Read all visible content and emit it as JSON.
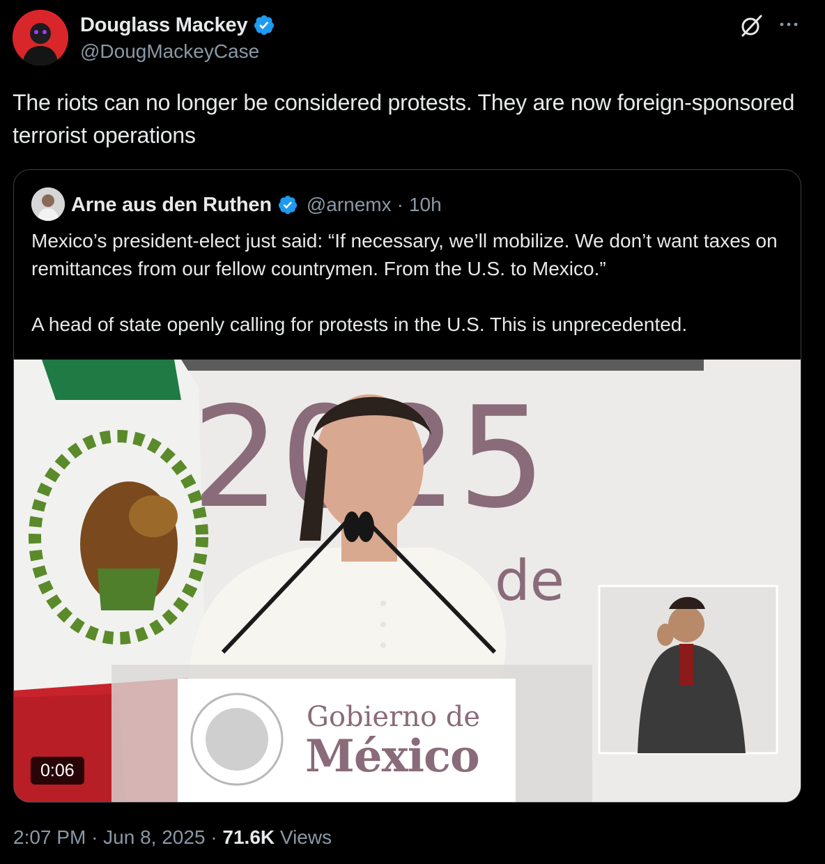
{
  "author": {
    "name": "Douglass Mackey",
    "handle": "@DougMackeyCase"
  },
  "tweet": {
    "text": "The riots can no longer be considered protests. They are now foreign-sponsored terrorist operations"
  },
  "quoted": {
    "name": "Arne aus den Ruthen",
    "handle": "@arnemx",
    "separator": "·",
    "time": "10h",
    "paragraph_1": "Mexico’s president-elect just said: “If necessary, we’ll mobilize. We don’t want taxes on remittances from our fellow countrymen. From the U.S. to Mexico.”",
    "paragraph_2": "A head of state openly calling for protests in the U.S. This is unprecedented.",
    "video": {
      "duration": "0:06",
      "backdrop_text_year": "2025",
      "backdrop_text_de": "de",
      "podium_line_1": "Gobierno de",
      "podium_line_2": "México"
    }
  },
  "meta": {
    "time": "2:07 PM",
    "separator_1": "·",
    "date": "Jun 8, 2025",
    "separator_2": "·",
    "views_count": "71.6K",
    "views_label": "Views"
  },
  "colors": {
    "background": "#000000",
    "text_primary": "#e7e9ea",
    "text_secondary": "#8b98a5",
    "verified_blue": "#1d9bf0",
    "card_border": "#3a3f44"
  },
  "icons": {
    "verified": "verified-badge-icon",
    "grok": "grok-icon",
    "more": "more-dots-icon"
  }
}
